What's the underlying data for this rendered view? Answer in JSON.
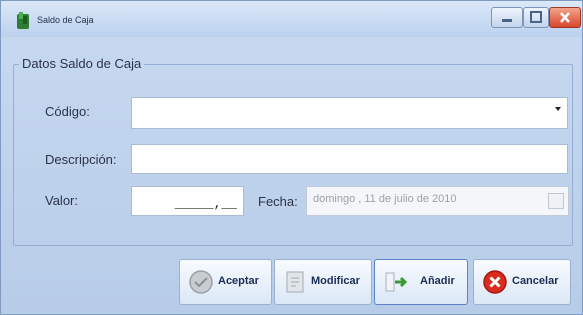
{
  "window": {
    "title": "Saldo de Caja"
  },
  "group": {
    "label": "Datos Saldo de Caja"
  },
  "fields": {
    "codigo_label": "Código:",
    "codigo_value": "",
    "descripcion_label": "Descripción:",
    "descripcion_value": "",
    "valor_label": "Valor:",
    "valor_value": "_____,__",
    "fecha_label": "Fecha:",
    "fecha_value": "domingo , 11 de julio de 2010"
  },
  "buttons": {
    "aceptar": "Aceptar",
    "modificar": "Modificar",
    "anadir": "Añadir",
    "cancelar": "Cancelar"
  }
}
